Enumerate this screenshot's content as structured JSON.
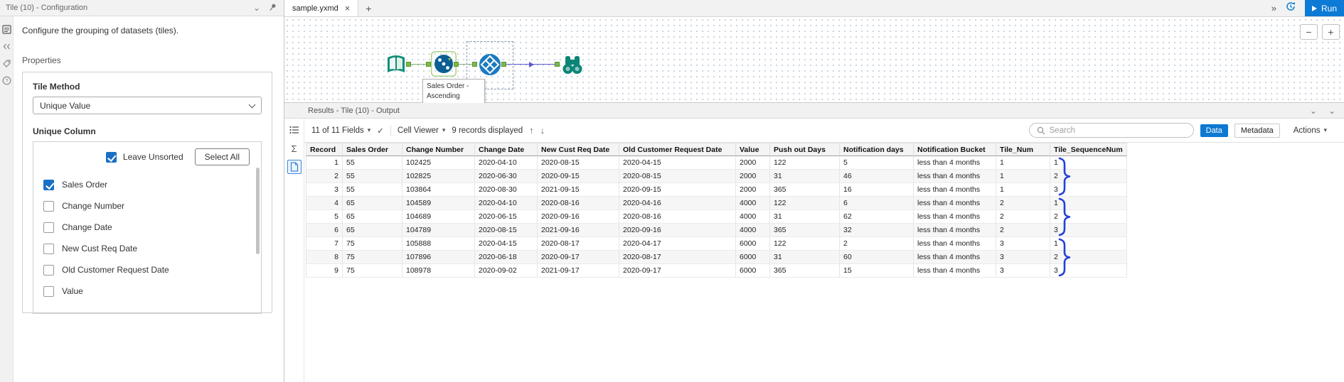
{
  "config_panel": {
    "title": "Tile (10) - Configuration",
    "description": "Configure the grouping of datasets (tiles).",
    "properties_label": "Properties",
    "tile_method": {
      "label": "Tile Method",
      "value": "Unique Value"
    },
    "unique_column": {
      "label": "Unique Column",
      "leave_unsorted_label": "Leave Unsorted",
      "leave_unsorted_checked": true,
      "select_all_label": "Select All",
      "columns": [
        {
          "label": "Sales Order",
          "checked": true
        },
        {
          "label": "Change Number",
          "checked": false
        },
        {
          "label": "Change Date",
          "checked": false
        },
        {
          "label": "New Cust Req Date",
          "checked": false
        },
        {
          "label": "Old Customer Request Date",
          "checked": false
        },
        {
          "label": "Value",
          "checked": false
        }
      ]
    }
  },
  "canvas": {
    "tab_label": "sample.yxmd",
    "run_label": "Run",
    "annotation_text": "Sales Order - Ascending",
    "tools": [
      "input-data",
      "sort",
      "tile",
      "browse"
    ]
  },
  "results": {
    "title": "Results - Tile (10) - Output",
    "toolbar": {
      "fields_label": "11 of 11 Fields",
      "cell_viewer_label": "Cell Viewer",
      "records_label": "9 records displayed",
      "search_placeholder": "Search",
      "data_label": "Data",
      "metadata_label": "Metadata",
      "actions_label": "Actions"
    },
    "table": {
      "columns": [
        "Record",
        "Sales Order",
        "Change Number",
        "Change Date",
        "New Cust Req Date",
        "Old Customer Request Date",
        "Value",
        "Push out Days",
        "Notification days",
        "Notification Bucket",
        "Tile_Num",
        "Tile_SequenceNum"
      ],
      "rows": [
        [
          "1",
          "55",
          "102425",
          "2020-04-10",
          "2020-08-15",
          "2020-04-15",
          "2000",
          "122",
          "5",
          "less than 4 months",
          "1",
          "1"
        ],
        [
          "2",
          "55",
          "102825",
          "2020-06-30",
          "2020-09-15",
          "2020-08-15",
          "2000",
          "31",
          "46",
          "less than 4 months",
          "1",
          "2"
        ],
        [
          "3",
          "55",
          "103864",
          "2020-08-30",
          "2021-09-15",
          "2020-09-15",
          "2000",
          "365",
          "16",
          "less than 4 months",
          "1",
          "3"
        ],
        [
          "4",
          "65",
          "104589",
          "2020-04-10",
          "2020-08-16",
          "2020-04-16",
          "4000",
          "122",
          "6",
          "less than 4 months",
          "2",
          "1"
        ],
        [
          "5",
          "65",
          "104689",
          "2020-06-15",
          "2020-09-16",
          "2020-08-16",
          "4000",
          "31",
          "62",
          "less than 4 months",
          "2",
          "2"
        ],
        [
          "6",
          "65",
          "104789",
          "2020-08-15",
          "2021-09-16",
          "2020-09-16",
          "4000",
          "365",
          "32",
          "less than 4 months",
          "2",
          "3"
        ],
        [
          "7",
          "75",
          "105888",
          "2020-04-15",
          "2020-08-17",
          "2020-04-17",
          "6000",
          "122",
          "2",
          "less than 4 months",
          "3",
          "1"
        ],
        [
          "8",
          "75",
          "107896",
          "2020-06-18",
          "2020-09-17",
          "2020-08-17",
          "6000",
          "31",
          "60",
          "less than 4 months",
          "3",
          "2"
        ],
        [
          "9",
          "75",
          "108978",
          "2020-09-02",
          "2021-09-17",
          "2020-09-17",
          "6000",
          "365",
          "15",
          "less than 4 months",
          "3",
          "3"
        ]
      ]
    },
    "row_groups": [
      [
        1,
        3
      ],
      [
        4,
        6
      ],
      [
        7,
        9
      ]
    ]
  },
  "glyphs": {
    "chevron_down": "⌄",
    "caret_down": "▾",
    "close": "×",
    "plus": "+",
    "double_chevron_right": "»",
    "check": "✓",
    "arrow_up": "↑",
    "arrow_down": "↓",
    "minus": "−",
    "sigma": "Σ"
  },
  "colors": {
    "accent_blue": "#0d7ad5",
    "checkbox_blue": "#1a6fc4",
    "brace_blue": "#2440d8"
  }
}
